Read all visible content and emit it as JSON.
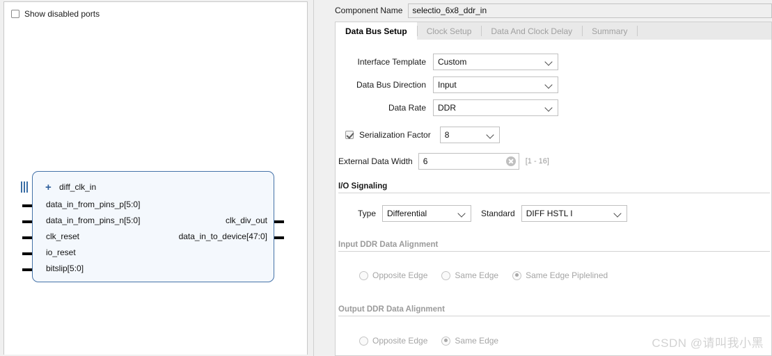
{
  "left_panel": {
    "show_disabled_ports": {
      "label": "Show disabled ports",
      "checked": false
    },
    "symbol": {
      "expand_icon": "+",
      "bus_icon": "bus-port-icon",
      "left_ports": [
        {
          "name": "diff_clk_in",
          "kind": "bus",
          "expandable": true
        },
        {
          "name": "data_in_from_pins_p[5:0]",
          "kind": "single",
          "expandable": false
        },
        {
          "name": "data_in_from_pins_n[5:0]",
          "kind": "single",
          "expandable": false
        },
        {
          "name": "clk_reset",
          "kind": "single",
          "expandable": false
        },
        {
          "name": "io_reset",
          "kind": "single",
          "expandable": false
        },
        {
          "name": "bitslip[5:0]",
          "kind": "single",
          "expandable": false
        }
      ],
      "right_ports": [
        {
          "name": "clk_div_out"
        },
        {
          "name": "data_in_to_device[47:0]"
        }
      ],
      "fill_color": "#f4f8fd",
      "border_color": "#4472a8"
    }
  },
  "right_panel": {
    "component_name": {
      "label": "Component Name",
      "value": "selectio_6x8_ddr_in"
    },
    "tabs": [
      {
        "label": "Data Bus Setup",
        "active": true
      },
      {
        "label": "Clock Setup",
        "active": false
      },
      {
        "label": "Data And Clock Delay",
        "active": false
      },
      {
        "label": "Summary",
        "active": false
      }
    ],
    "fields": {
      "interface_template": {
        "label": "Interface Template",
        "value": "Custom",
        "options": [
          "Custom"
        ]
      },
      "data_bus_direction": {
        "label": "Data Bus Direction",
        "value": "Input",
        "options": [
          "Input"
        ]
      },
      "data_rate": {
        "label": "Data Rate",
        "value": "DDR",
        "options": [
          "DDR"
        ]
      },
      "serialization_factor": {
        "label": "Serialization Factor",
        "checked": true,
        "value": "8",
        "options": [
          "8"
        ]
      },
      "external_data_width": {
        "label": "External Data Width",
        "value": "6",
        "range_hint": "[1 - 16]",
        "clear_icon": "clear-circle-icon"
      }
    },
    "io_signaling": {
      "title": "I/O Signaling",
      "type": {
        "label": "Type",
        "value": "Differential",
        "options": [
          "Differential"
        ]
      },
      "standard": {
        "label": "Standard",
        "value": "DIFF HSTL I",
        "options": [
          "DIFF HSTL I"
        ]
      }
    },
    "input_ddr_alignment": {
      "title": "Input DDR Data Alignment",
      "disabled": true,
      "options": [
        {
          "label": "Opposite Edge",
          "selected": false
        },
        {
          "label": "Same Edge",
          "selected": false
        },
        {
          "label": "Same Edge Piplelined",
          "selected": true
        }
      ]
    },
    "output_ddr_alignment": {
      "title": "Output DDR Data Alignment",
      "disabled": true,
      "options": [
        {
          "label": "Opposite Edge",
          "selected": false
        },
        {
          "label": "Same Edge",
          "selected": true
        }
      ]
    }
  },
  "watermark": {
    "text": "CSDN @请叫我小黑"
  }
}
